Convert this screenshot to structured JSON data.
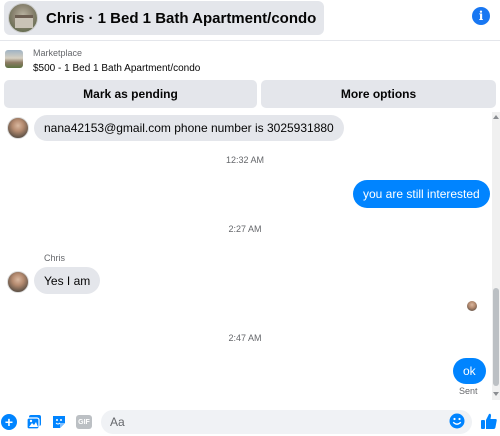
{
  "header": {
    "title": "Chris · 1 Bed 1 Bath Apartment/condo",
    "info_glyph": "i"
  },
  "listing": {
    "type": "Marketplace",
    "description": "$500 - 1 Bed 1 Bath Apartment/condo"
  },
  "actions": {
    "mark_pending": "Mark as pending",
    "more_options": "More options"
  },
  "messages": {
    "m1_text": "nana42153@gmail.com phone number is 3025931880",
    "t1": "12:32 AM",
    "m2_text": "you are still interested",
    "t2": "2:27 AM",
    "m3_sender": "Chris",
    "m3_text": "Yes I am",
    "t3": "2:47 AM",
    "m4_text": "ok",
    "m4_status": "Sent"
  },
  "composer": {
    "placeholder": "Aa",
    "gif_label": "GIF"
  },
  "colors": {
    "accent": "#0084ff",
    "incoming_bubble": "#e4e6eb",
    "info": "#1877f2"
  },
  "icons": [
    "info-icon",
    "plus-icon",
    "photo-icon",
    "sticker-icon",
    "gif-icon",
    "emoji-icon",
    "thumbs-up-icon"
  ]
}
